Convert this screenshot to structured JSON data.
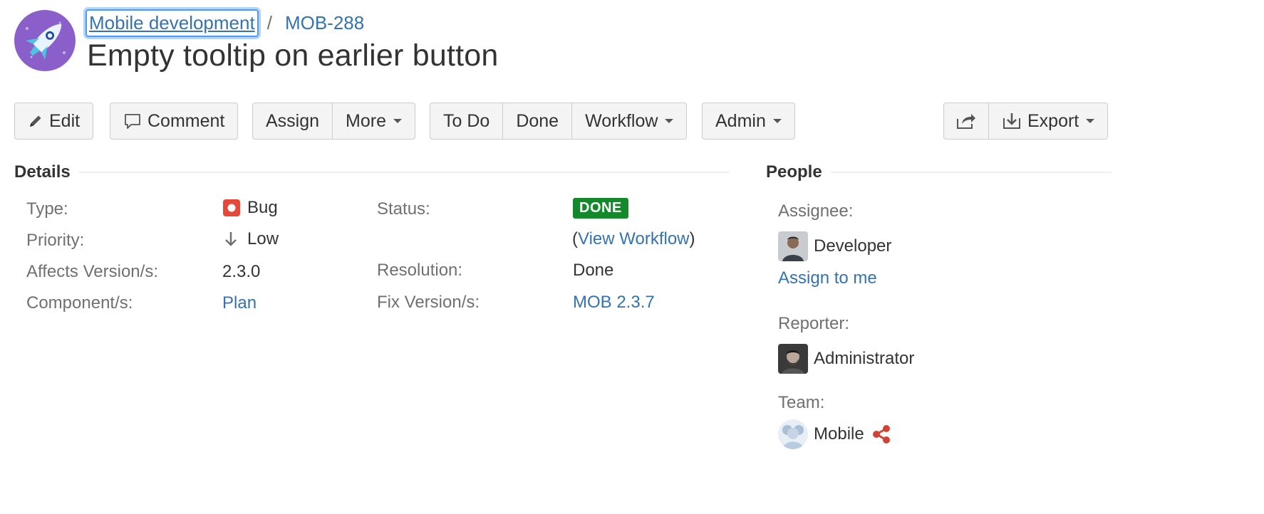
{
  "colors": {
    "link": "#3572b0",
    "status_done": "#14892c",
    "bug_red": "#e5493a",
    "project_purple": "#8a5fc9",
    "share_red": "#d04437"
  },
  "header": {
    "project_name": "Mobile development",
    "separator": "/",
    "issue_key": "MOB-288",
    "title": "Empty tooltip on earlier button",
    "project_icon": "rocket-icon"
  },
  "toolbar": {
    "edit": "Edit",
    "comment": "Comment",
    "assign": "Assign",
    "more": "More",
    "todo": "To Do",
    "done": "Done",
    "workflow": "Workflow",
    "admin": "Admin",
    "export": "Export"
  },
  "details": {
    "heading": "Details",
    "type_label": "Type:",
    "type_value": "Bug",
    "priority_label": "Priority:",
    "priority_value": "Low",
    "affects_label": "Affects Version/s:",
    "affects_value": "2.3.0",
    "component_label": "Component/s:",
    "component_value": "Plan",
    "status_label": "Status:",
    "status_value": "DONE",
    "view_workflow_open": "(",
    "view_workflow": "View Workflow",
    "view_workflow_close": ")",
    "resolution_label": "Resolution:",
    "resolution_value": "Done",
    "fix_label": "Fix Version/s:",
    "fix_value": "MOB 2.3.7"
  },
  "people": {
    "heading": "People",
    "assignee_label": "Assignee:",
    "assignee_name": "Developer",
    "assign_to_me": "Assign to me",
    "reporter_label": "Reporter:",
    "reporter_name": "Administrator",
    "team_label": "Team:",
    "team_name": "Mobile"
  }
}
